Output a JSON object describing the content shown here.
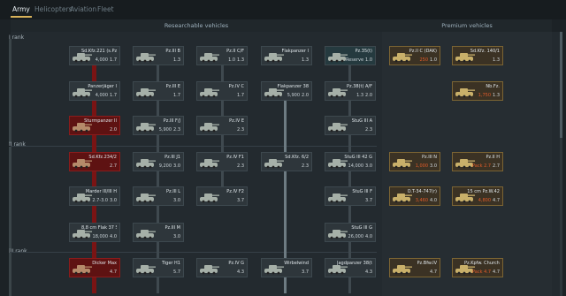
{
  "tabs": [
    {
      "label": "Army",
      "active": true
    },
    {
      "label": "Helicopters"
    },
    {
      "label": "Aviation"
    },
    {
      "label": "Fleet"
    }
  ],
  "headers": {
    "research": "Researchable vehicles",
    "premium": "Premium vehicles"
  },
  "ranks": {
    "r1": "I rank",
    "r2": "II rank",
    "r3": "III rank"
  },
  "vehicles": [
    {
      "name": "Sd.Kfz.221 (s.Pz.B.41)",
      "meta": "4,000",
      "br": "1.7"
    },
    {
      "name": "Pz.III B",
      "meta": "",
      "br": "1.3"
    },
    {
      "name": "Pz.II C/F",
      "meta": "1.0",
      "br": "1.3"
    },
    {
      "name": "Flakpanzer I",
      "meta": "",
      "br": "1.3"
    },
    {
      "name": "Pz.35(t)",
      "meta": "Reserve",
      "br": "1.0"
    },
    {
      "name": "Pz.II C (DAK)",
      "meta": "250",
      "br": "1.0"
    },
    {
      "name": "Sd.Kfz. 140/1",
      "meta": "",
      "br": "1.3"
    },
    {
      "name": "Panzerjäger I",
      "meta": "4,000",
      "br": "1.7"
    },
    {
      "name": "Pz.III E",
      "meta": "",
      "br": "1.7"
    },
    {
      "name": "Pz.IV C",
      "meta": "",
      "br": "1.7"
    },
    {
      "name": "Flakpanzer 38",
      "meta": "5,900",
      "br": "2.0"
    },
    {
      "name": "Pz.38(t) A/F",
      "meta": "1.3",
      "br": "2.0"
    },
    {
      "name": "Nb.Fz.",
      "meta": "1,750",
      "br": "1.3"
    },
    {
      "name": "Sturmpanzer II",
      "meta": "",
      "br": "2.0"
    },
    {
      "name": "Pz.III F/J",
      "meta": "5,900",
      "br": "2.3"
    },
    {
      "name": "Pz.IV E",
      "meta": "",
      "br": "2.3"
    },
    {
      "name": "StuG III A",
      "meta": "",
      "br": "2.3"
    },
    {
      "name": "Sd.Kfz.234/2",
      "meta": "",
      "br": "2.7"
    },
    {
      "name": "Pz.III J1",
      "meta": "9,200",
      "br": "3.0"
    },
    {
      "name": "Pz.IV F1",
      "meta": "",
      "br": "2.3"
    },
    {
      "name": "Sd.Kfz. 6/2",
      "meta": "",
      "br": "2.3"
    },
    {
      "name": "StuG III 42 G",
      "meta": "14,000",
      "br": "3.0"
    },
    {
      "name": "Pz.III N",
      "meta": "1,000",
      "br": "3.0"
    },
    {
      "name": "Pz.II H",
      "meta": "Pack 2.7",
      "br": "2.7"
    },
    {
      "name": "Marder III/III H",
      "meta": "2.7-3.0",
      "br": "3.0"
    },
    {
      "name": "Pz.III L",
      "meta": "",
      "br": "3.0"
    },
    {
      "name": "Pz.IV F2",
      "meta": "",
      "br": "3.7"
    },
    {
      "name": "StuG III F",
      "meta": "",
      "br": "3.7"
    },
    {
      "name": "O.T-34-747(r)",
      "meta": "3,460",
      "br": "4.0"
    },
    {
      "name": "15 cm Pz.W.42",
      "meta": "4,800",
      "br": "4.7"
    },
    {
      "name": "8,8 cm Flak 37 Sfl.",
      "meta": "18,000",
      "br": "4.0"
    },
    {
      "name": "Pz.III M",
      "meta": "",
      "br": "3.0"
    },
    {
      "name": "StuG III G",
      "meta": "26,000",
      "br": "4.0"
    },
    {
      "name": "Dicker Max",
      "meta": "",
      "br": "4.7"
    },
    {
      "name": "Tiger H1",
      "meta": "",
      "br": "5.7"
    },
    {
      "name": "Pz.IV G",
      "meta": "",
      "br": "4.3"
    },
    {
      "name": "Wirbelwind",
      "meta": "",
      "br": "3.7"
    },
    {
      "name": "Jagdpanzer 38(t)",
      "meta": "",
      "br": "4.3"
    },
    {
      "name": "Pz.Bfw.IV",
      "meta": "",
      "br": "4.7"
    },
    {
      "name": "Pz.Kpfw. Churchill",
      "meta": "Pack 4.7",
      "br": "4.7"
    }
  ]
}
